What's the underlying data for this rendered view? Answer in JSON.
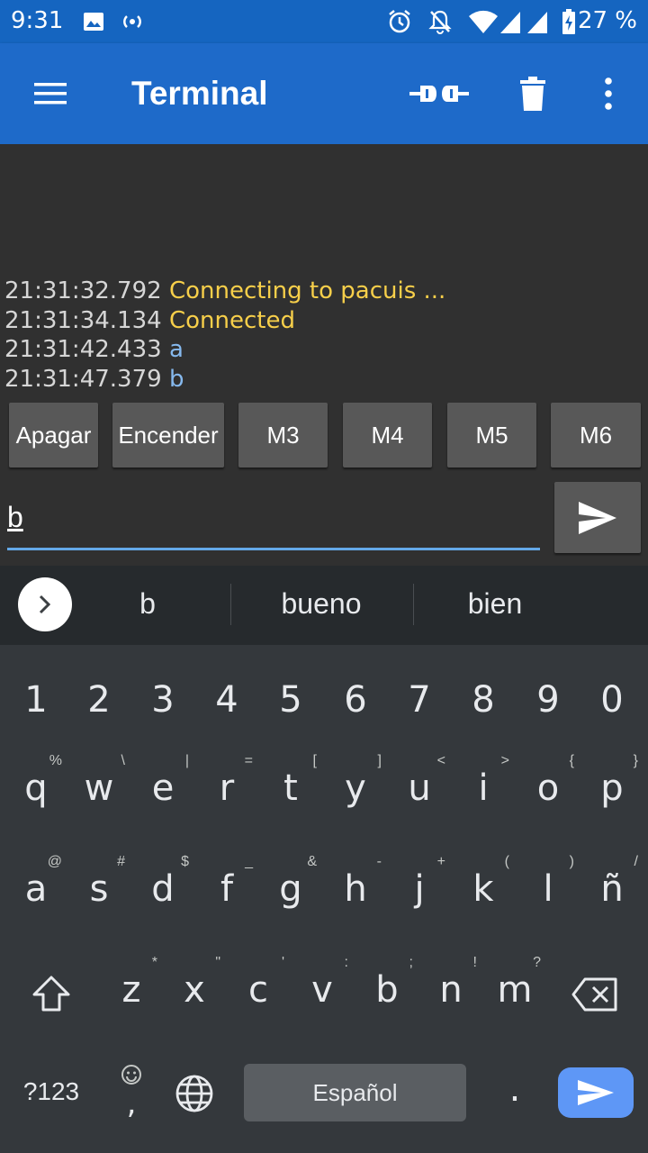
{
  "status_bar": {
    "time": "9:31",
    "battery_percent": "27 %",
    "icons": [
      "image-icon",
      "broadcast-icon",
      "alarm-icon",
      "notifications-off-icon",
      "wifi-icon",
      "signal-icon",
      "signal-icon-2",
      "battery-charging-icon"
    ]
  },
  "app_bar": {
    "title": "Terminal",
    "actions": [
      "connect-plug-icon",
      "delete-icon",
      "more-vert-icon"
    ]
  },
  "terminal": {
    "lines": [
      {
        "timestamp": "21:31:32.792",
        "text": "Connecting to pacuis ..."
      },
      {
        "timestamp": "21:31:34.134",
        "text": "Connected"
      },
      {
        "timestamp": "21:31:42.433",
        "text": "a"
      },
      {
        "timestamp": "21:31:47.379",
        "text": "b"
      }
    ]
  },
  "macros": [
    "Apagar",
    "Encender",
    "M3",
    "M4",
    "M5",
    "M6"
  ],
  "input": {
    "value": "b"
  },
  "suggestions": [
    "b",
    "bueno",
    "bien"
  ],
  "keyboard": {
    "numbers": [
      "1",
      "2",
      "3",
      "4",
      "5",
      "6",
      "7",
      "8",
      "9",
      "0"
    ],
    "row1": {
      "keys": [
        "q",
        "w",
        "e",
        "r",
        "t",
        "y",
        "u",
        "i",
        "o",
        "p"
      ],
      "hints": [
        "%",
        "\\",
        "|",
        "=",
        "[",
        "]",
        "<",
        ">",
        "{",
        "}"
      ]
    },
    "row2": {
      "keys": [
        "a",
        "s",
        "d",
        "f",
        "g",
        "h",
        "j",
        "k",
        "l",
        "ñ"
      ],
      "hints": [
        "@",
        "#",
        "$",
        "_",
        "&",
        "-",
        "+",
        "(",
        ")",
        "/"
      ]
    },
    "row3": {
      "keys": [
        "z",
        "x",
        "c",
        "v",
        "b",
        "n",
        "m"
      ],
      "hints": [
        "*",
        "\"",
        "'",
        ":",
        ";",
        "!",
        "?"
      ]
    },
    "symbols_label": "?123",
    "comma": ",",
    "space_label": "Español",
    "period": "."
  },
  "colors": {
    "app_bar": "#1e6ac9",
    "status_bar": "#1565c0",
    "status_text": "#f7cf4a",
    "received_text": "#86b9ee"
  }
}
